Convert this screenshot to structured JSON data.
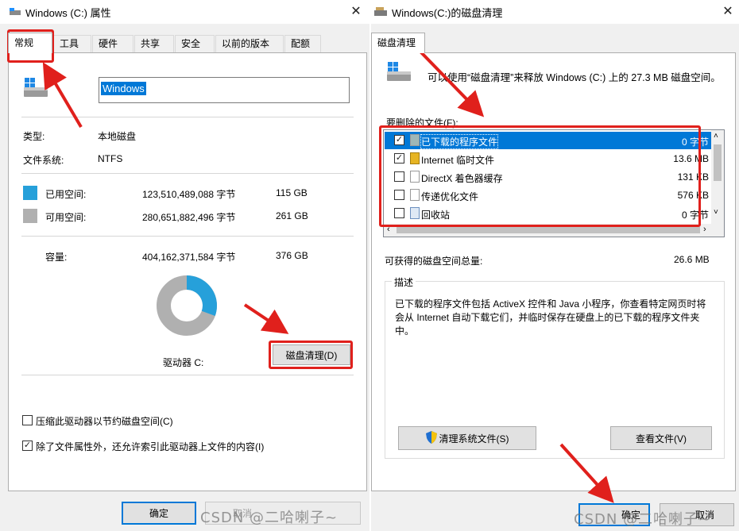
{
  "left_window": {
    "title": "Windows (C:) 属性",
    "close": "✕",
    "tabs": [
      "常规",
      "工具",
      "硬件",
      "共享",
      "安全",
      "以前的版本",
      "配额"
    ],
    "drive_name": "Windows",
    "type_label": "类型:",
    "type_value": "本地磁盘",
    "fs_label": "文件系统:",
    "fs_value": "NTFS",
    "used_label": "已用空间:",
    "used_bytes": "123,510,489,088 字节",
    "used_size": "115 GB",
    "free_label": "可用空间:",
    "free_bytes": "280,651,882,496 字节",
    "free_size": "261 GB",
    "capacity_label": "容量:",
    "capacity_bytes": "404,162,371,584 字节",
    "capacity_size": "376 GB",
    "drive_caption": "驱动器 C:",
    "cleanup_button": "磁盘清理(D)",
    "compress_option": "压缩此驱动器以节约磁盘空间(C)",
    "index_option": "除了文件属性外，还允许索引此驱动器上文件的内容(I)",
    "ok_button": "确定",
    "cancel_button": "取消",
    "colors": {
      "used": "#26a0da",
      "free": "#b0b0b0"
    }
  },
  "right_window": {
    "title": "Windows(C:)的磁盘清理",
    "close": "✕",
    "tab": "磁盘清理",
    "intro": "可以使用“磁盘清理”来释放 Windows (C:) 上的 27.3 MB 磁盘空间。",
    "files_label": "要删除的文件(F):",
    "files": [
      {
        "name": "已下载的程序文件",
        "size": "0 字节",
        "checked": true,
        "selected": true
      },
      {
        "name": "Internet 临时文件",
        "size": "13.6 MB",
        "checked": true,
        "selected": false
      },
      {
        "name": "DirectX 着色器缓存",
        "size": "131 KB",
        "checked": false,
        "selected": false
      },
      {
        "name": "传递优化文件",
        "size": "576 KB",
        "checked": false,
        "selected": false
      },
      {
        "name": "回收站",
        "size": "0 字节",
        "checked": false,
        "selected": false
      }
    ],
    "total_label": "可获得的磁盘空间总量:",
    "total_value": "26.6 MB",
    "desc_label": "描述",
    "desc_text": "已下载的程序文件包括 ActiveX 控件和 Java 小程序，你查看特定网页时将会从 Internet 自动下载它们，并临时保存在硬盘上的已下载的程序文件夹中。",
    "clean_system_button": "清理系统文件(S)",
    "view_files_button": "查看文件(V)",
    "ok_button": "确定",
    "cancel_button": "取消"
  },
  "watermark": "CSDN @二哈喇子~"
}
